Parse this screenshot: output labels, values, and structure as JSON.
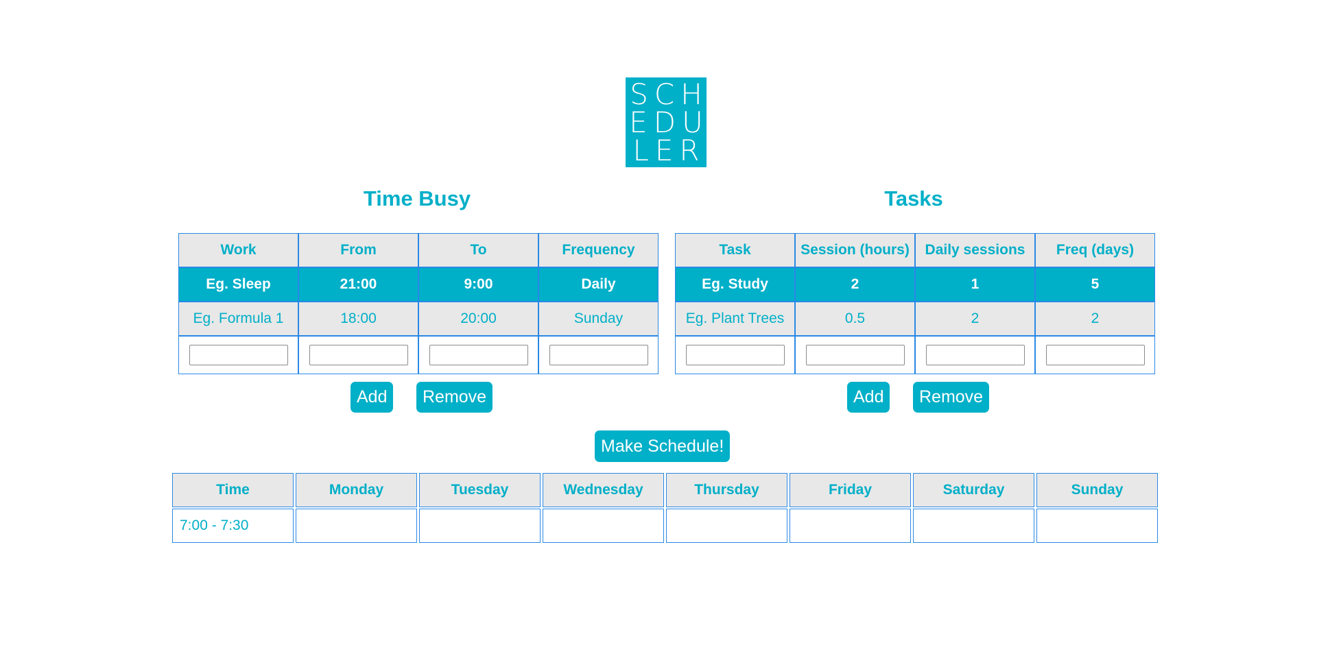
{
  "logo": {
    "line1": "SCH",
    "line2": "EDU",
    "line3": "LER"
  },
  "busy": {
    "title": "Time Busy",
    "headers": [
      "Work",
      "From",
      "To",
      "Frequency"
    ],
    "rows": [
      [
        "Eg. Sleep",
        "21:00",
        "9:00",
        "Daily"
      ],
      [
        "Eg. Formula 1",
        "18:00",
        "20:00",
        "Sunday"
      ]
    ],
    "add_label": "Add",
    "remove_label": "Remove"
  },
  "tasks": {
    "title": "Tasks",
    "headers": [
      "Task",
      "Session (hours)",
      "Daily sessions",
      "Freq (days)"
    ],
    "rows": [
      [
        "Eg. Study",
        "2",
        "1",
        "5"
      ],
      [
        "Eg. Plant Trees",
        "0.5",
        "2",
        "2"
      ]
    ],
    "add_label": "Add",
    "remove_label": "Remove"
  },
  "make_schedule_label": "Make Schedule!",
  "schedule": {
    "headers": [
      "Time",
      "Monday",
      "Tuesday",
      "Wednesday",
      "Thursday",
      "Friday",
      "Saturday",
      "Sunday"
    ],
    "rows": [
      [
        "7:00 - 7:30"
      ]
    ]
  },
  "colors": {
    "accent": "#00afc8",
    "border": "#2a88e6",
    "header_bg": "#e8e8e8"
  }
}
